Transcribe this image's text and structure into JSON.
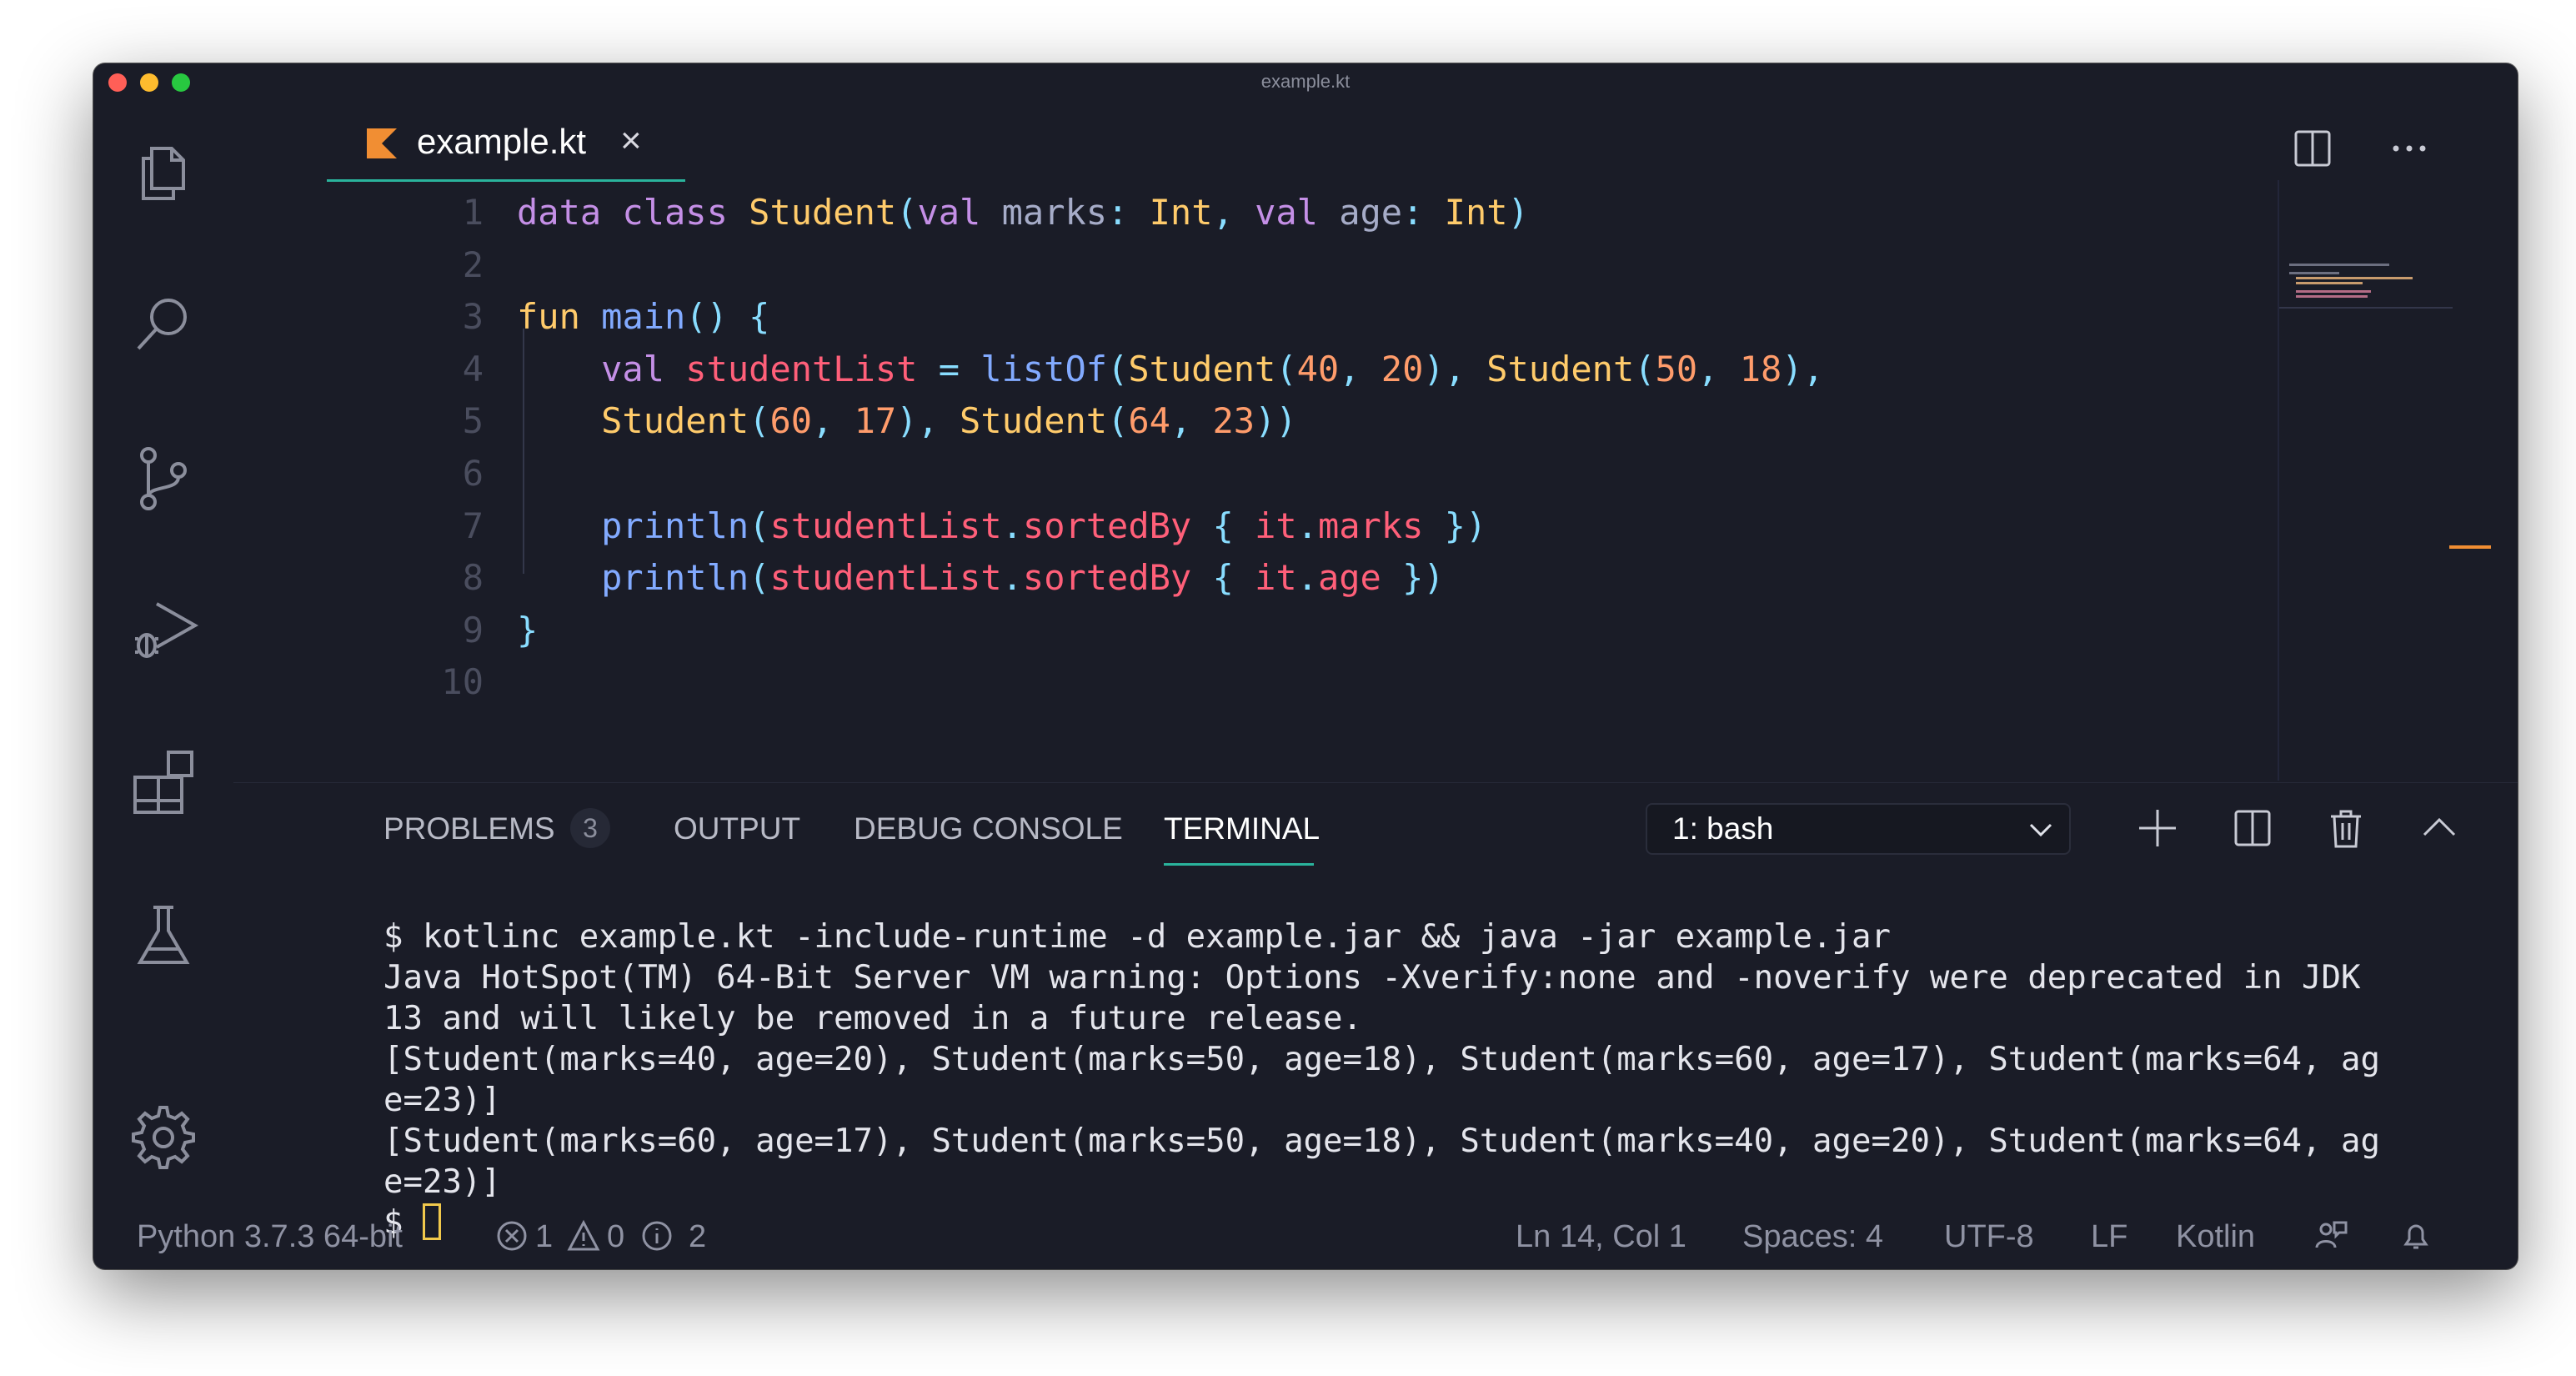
{
  "window": {
    "title": "example.kt"
  },
  "colors": {
    "accent": "#2ab39c",
    "background": "#1a1c27",
    "red": "#ff5f57",
    "yellow": "#febc2e",
    "green": "#28c840",
    "kotlin": "#f18e33"
  },
  "activity_bar": {
    "icons": [
      "files-icon",
      "search-icon",
      "source-control-icon",
      "run-debug-icon",
      "extensions-icon",
      "testing-icon",
      "settings-gear-icon"
    ]
  },
  "editor": {
    "tab": {
      "label": "example.kt",
      "icon": "kotlin-logo-icon"
    },
    "line_numbers": [
      "1",
      "2",
      "3",
      "4",
      "5",
      "6",
      "7",
      "8",
      "9",
      "10"
    ],
    "lines": [
      [
        {
          "t": "data class ",
          "c": "kw"
        },
        {
          "t": "Student",
          "c": "ty"
        },
        {
          "t": "(",
          "c": "pn"
        },
        {
          "t": "val ",
          "c": "kw"
        },
        {
          "t": "marks",
          "c": "pr"
        },
        {
          "t": ": ",
          "c": "pn"
        },
        {
          "t": "Int",
          "c": "ty"
        },
        {
          "t": ", ",
          "c": "pn"
        },
        {
          "t": "val ",
          "c": "kw"
        },
        {
          "t": "age",
          "c": "pr"
        },
        {
          "t": ": ",
          "c": "pn"
        },
        {
          "t": "Int",
          "c": "ty"
        },
        {
          "t": ")",
          "c": "pn"
        }
      ],
      [],
      [
        {
          "t": "fun ",
          "c": "ty"
        },
        {
          "t": "main",
          "c": "fn"
        },
        {
          "t": "() {",
          "c": "pn"
        }
      ],
      [
        {
          "t": "    val ",
          "c": "kw"
        },
        {
          "t": "studentList",
          "c": "vr"
        },
        {
          "t": " = ",
          "c": "op"
        },
        {
          "t": "listOf",
          "c": "fn"
        },
        {
          "t": "(",
          "c": "pn"
        },
        {
          "t": "Student",
          "c": "ty"
        },
        {
          "t": "(",
          "c": "pn"
        },
        {
          "t": "40",
          "c": "nm"
        },
        {
          "t": ", ",
          "c": "pn"
        },
        {
          "t": "20",
          "c": "nm"
        },
        {
          "t": "), ",
          "c": "pn"
        },
        {
          "t": "Student",
          "c": "ty"
        },
        {
          "t": "(",
          "c": "pn"
        },
        {
          "t": "50",
          "c": "nm"
        },
        {
          "t": ", ",
          "c": "pn"
        },
        {
          "t": "18",
          "c": "nm"
        },
        {
          "t": "),",
          "c": "pn"
        }
      ],
      [
        {
          "t": "    Student",
          "c": "ty"
        },
        {
          "t": "(",
          "c": "pn"
        },
        {
          "t": "60",
          "c": "nm"
        },
        {
          "t": ", ",
          "c": "pn"
        },
        {
          "t": "17",
          "c": "nm"
        },
        {
          "t": "), ",
          "c": "pn"
        },
        {
          "t": "Student",
          "c": "ty"
        },
        {
          "t": "(",
          "c": "pn"
        },
        {
          "t": "64",
          "c": "nm"
        },
        {
          "t": ", ",
          "c": "pn"
        },
        {
          "t": "23",
          "c": "nm"
        },
        {
          "t": "))",
          "c": "pn"
        }
      ],
      [],
      [
        {
          "t": "    println",
          "c": "fn"
        },
        {
          "t": "(",
          "c": "pn"
        },
        {
          "t": "studentList",
          "c": "vr"
        },
        {
          "t": ".",
          "c": "pn"
        },
        {
          "t": "sortedBy",
          "c": "vr"
        },
        {
          "t": " { ",
          "c": "pn"
        },
        {
          "t": "it",
          "c": "vr"
        },
        {
          "t": ".",
          "c": "pn"
        },
        {
          "t": "marks",
          "c": "vr"
        },
        {
          "t": " })",
          "c": "pn"
        }
      ],
      [
        {
          "t": "    println",
          "c": "fn"
        },
        {
          "t": "(",
          "c": "pn"
        },
        {
          "t": "studentList",
          "c": "vr"
        },
        {
          "t": ".",
          "c": "pn"
        },
        {
          "t": "sortedBy",
          "c": "vr"
        },
        {
          "t": " { ",
          "c": "pn"
        },
        {
          "t": "it",
          "c": "vr"
        },
        {
          "t": ".",
          "c": "pn"
        },
        {
          "t": "age",
          "c": "vr"
        },
        {
          "t": " })",
          "c": "pn"
        }
      ],
      [
        {
          "t": "}",
          "c": "pn"
        }
      ],
      []
    ]
  },
  "panel": {
    "tabs": [
      {
        "label": "PROBLEMS",
        "badge": "3"
      },
      {
        "label": "OUTPUT"
      },
      {
        "label": "DEBUG CONSOLE"
      },
      {
        "label": "TERMINAL",
        "active": true
      }
    ],
    "terminal_select": "1: bash",
    "terminal_lines": [
      "$ kotlinc example.kt -include-runtime -d example.jar && java -jar example.jar",
      "Java HotSpot(TM) 64-Bit Server VM warning: Options -Xverify:none and -noverify were deprecated in JDK",
      "13 and will likely be removed in a future release.",
      "[Student(marks=40, age=20), Student(marks=50, age=18), Student(marks=60, age=17), Student(marks=64, ag",
      "e=23)]",
      "[Student(marks=60, age=17), Student(marks=50, age=18), Student(marks=40, age=20), Student(marks=64, ag",
      "e=23)]"
    ],
    "prompt": "$ "
  },
  "status_bar": {
    "python": "Python 3.7.3 64-bit",
    "errors": "1",
    "warnings": "0",
    "infos": "2",
    "position": "Ln 14, Col 1",
    "spaces": "Spaces: 4",
    "encoding": "UTF-8",
    "eol": "LF",
    "language": "Kotlin"
  }
}
